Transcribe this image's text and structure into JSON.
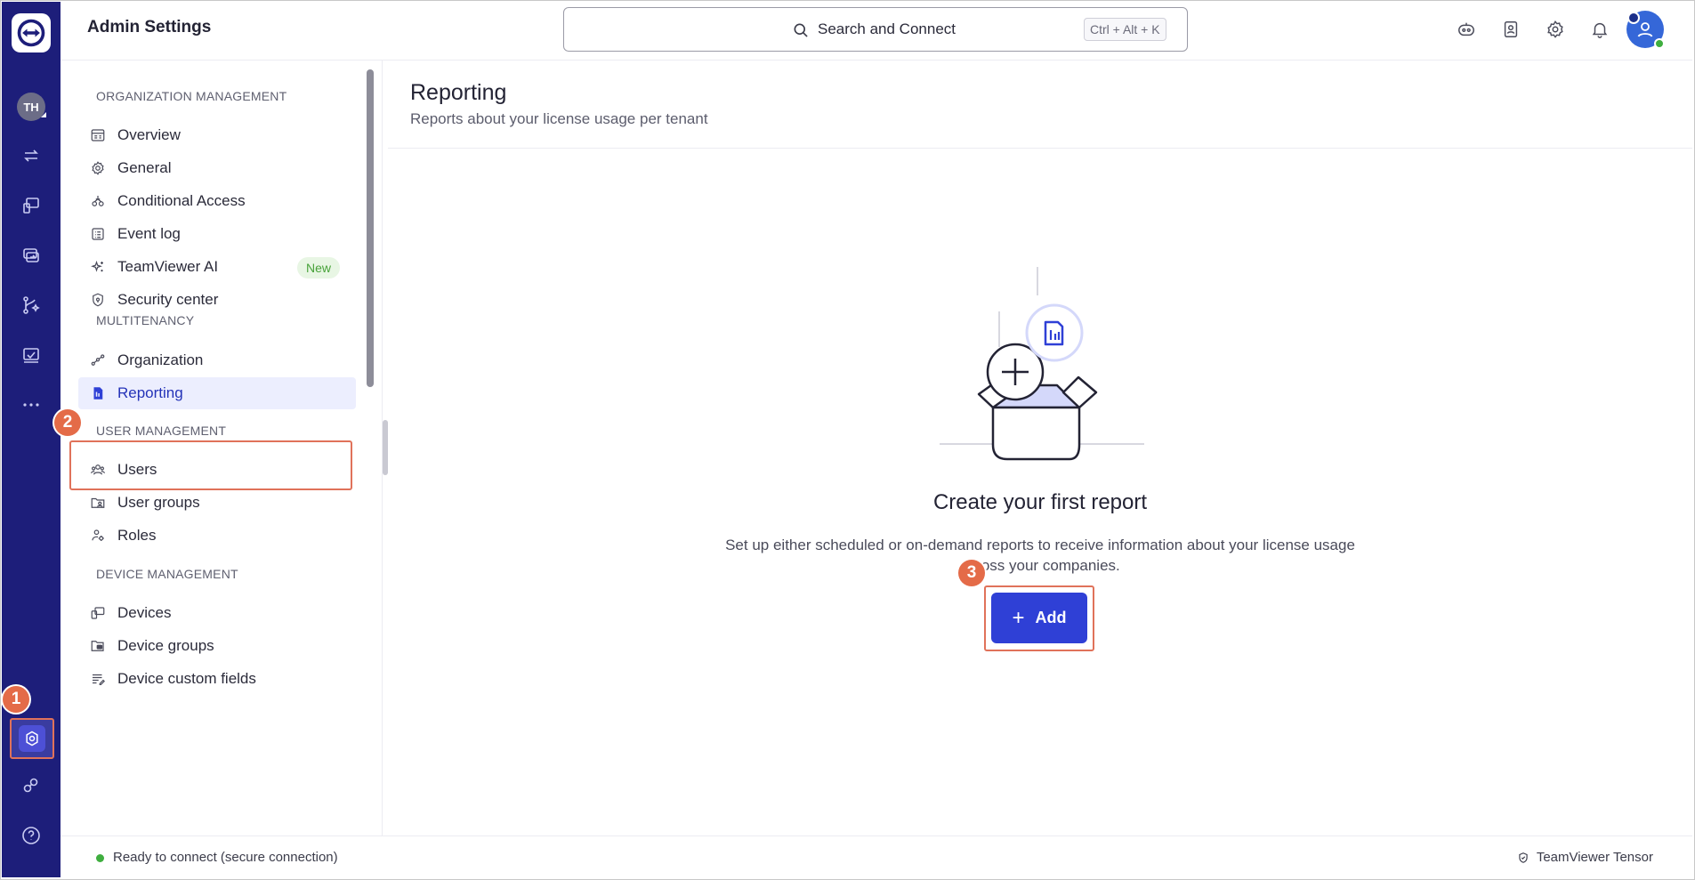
{
  "app": {
    "title": "Admin Settings"
  },
  "user": {
    "initials": "TH"
  },
  "search": {
    "placeholder": "Search and Connect",
    "shortcut": "Ctrl + Alt + K"
  },
  "steps": [
    "1",
    "2",
    "3"
  ],
  "nav": {
    "sections": [
      {
        "heading": "ORGANIZATION MANAGEMENT",
        "items": [
          {
            "label": "Overview",
            "icon": "overview-icon"
          },
          {
            "label": "General",
            "icon": "gear-icon"
          },
          {
            "label": "Conditional Access",
            "icon": "conditional-access-icon"
          },
          {
            "label": "Event log",
            "icon": "event-log-icon"
          },
          {
            "label": "TeamViewer AI",
            "icon": "sparkle-icon",
            "badge": "New"
          },
          {
            "label": "Security center",
            "icon": "shield-icon"
          }
        ]
      },
      {
        "heading": "MULTITENANCY",
        "items": [
          {
            "label": "Organization",
            "icon": "organization-icon"
          },
          {
            "label": "Reporting",
            "icon": "reporting-icon",
            "active": true
          }
        ]
      },
      {
        "heading": "USER MANAGEMENT",
        "items": [
          {
            "label": "Users",
            "icon": "users-icon"
          },
          {
            "label": "User groups",
            "icon": "user-groups-icon"
          },
          {
            "label": "Roles",
            "icon": "roles-icon"
          }
        ]
      },
      {
        "heading": "DEVICE MANAGEMENT",
        "items": [
          {
            "label": "Devices",
            "icon": "devices-icon"
          },
          {
            "label": "Device groups",
            "icon": "device-groups-icon"
          },
          {
            "label": "Device custom fields",
            "icon": "custom-fields-icon"
          }
        ]
      }
    ]
  },
  "main": {
    "title": "Reporting",
    "subtitle": "Reports about your license usage per tenant",
    "empty_title": "Create your first report",
    "empty_desc_line1": "Set up either scheduled or on-demand reports to receive information about your license usage",
    "empty_desc_line2": "across your companies.",
    "add_label": "Add"
  },
  "status": {
    "connection": "Ready to connect (secure connection)",
    "product": "TeamViewer Tensor"
  },
  "colors": {
    "rail": "#1d1e7a",
    "accent": "#2f40d6",
    "highlight": "#e0725a",
    "active_bg": "#eceefe"
  }
}
